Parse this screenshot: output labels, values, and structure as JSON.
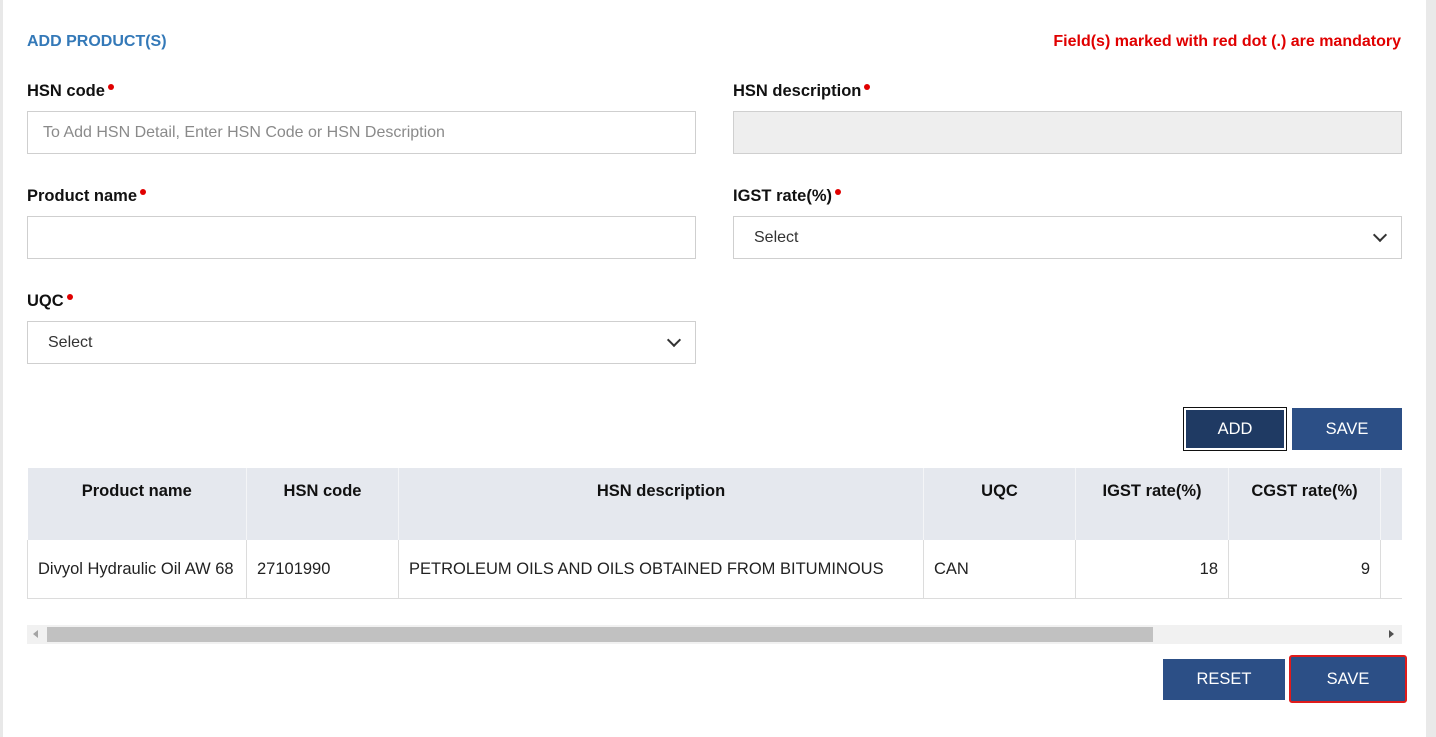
{
  "header": {
    "title": "ADD PRODUCT(S)",
    "mandatory_note": "Field(s) marked with red dot (.) are mandatory"
  },
  "form": {
    "hsn_code": {
      "label": "HSN code",
      "value": "",
      "placeholder": "To Add HSN Detail, Enter HSN Code or HSN Description"
    },
    "hsn_description": {
      "label": "HSN description",
      "value": ""
    },
    "product_name": {
      "label": "Product name",
      "value": ""
    },
    "igst_rate": {
      "label": "IGST rate(%)",
      "selected": "Select"
    },
    "uqc": {
      "label": "UQC",
      "selected": "Select"
    }
  },
  "buttons": {
    "add": "ADD",
    "save_top": "SAVE",
    "reset": "RESET",
    "save_bottom": "SAVE"
  },
  "table": {
    "headers": [
      "Product name",
      "HSN code",
      "HSN description",
      "UQC",
      "IGST rate(%)",
      "CGST rate(%)"
    ],
    "rows": [
      [
        "Divyol Hydraulic Oil AW 68",
        "27101990",
        "PETROLEUM OILS AND OILS OBTAINED FROM BITUMINOUS",
        "CAN",
        "18",
        "9"
      ]
    ]
  },
  "colors": {
    "accent": "#2c4f86",
    "title": "#3479b8",
    "required": "#e00000",
    "focus": "#e01b1b"
  },
  "icons": [
    "chevron-down-icon",
    "scroll-left-arrow-icon",
    "scroll-right-arrow-icon"
  ]
}
